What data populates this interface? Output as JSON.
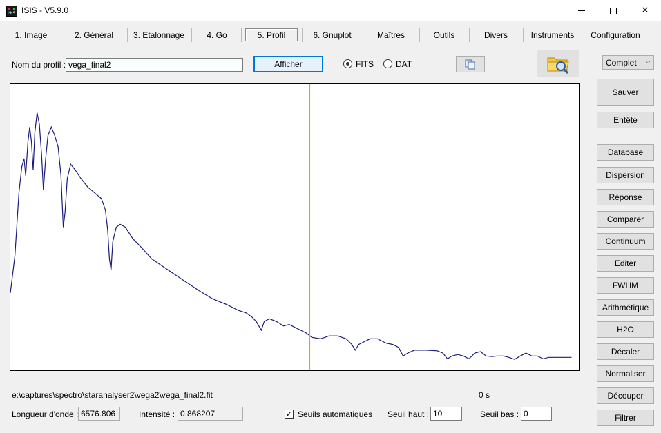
{
  "window": {
    "title": "ISIS - V5.9.0",
    "icon_text": "ISIS",
    "minimize_glyph": "",
    "maximize_glyph": "",
    "close_glyph": "✕"
  },
  "tabs": [
    {
      "label": "1. Image"
    },
    {
      "label": "2. Général"
    },
    {
      "label": "3. Etalonnage"
    },
    {
      "label": "4. Go"
    },
    {
      "label": "5. Profil",
      "active": true
    },
    {
      "label": "6. Gnuplot"
    },
    {
      "label": "Maîtres"
    },
    {
      "label": "Outils"
    },
    {
      "label": "Divers"
    },
    {
      "label": "Instruments"
    },
    {
      "label": "Configuration"
    }
  ],
  "profile": {
    "label": "Nom du profil :",
    "value": "vega_final2",
    "show_button": "Afficher",
    "format_options": [
      {
        "label": "FITS",
        "checked": true
      },
      {
        "label": "DAT",
        "checked": false
      }
    ],
    "copy_icon": "copy-icon",
    "open_icon": "folder-search-icon",
    "mode_select": "Complet",
    "mode_chevron": "⌵"
  },
  "chart_data": {
    "type": "line",
    "series_color": "#1a1a7a",
    "cursor_color": "#e0a030",
    "note": "spectrum profile, units not printed",
    "points_relative": [
      [
        0.0,
        0.27
      ],
      [
        0.008,
        0.4
      ],
      [
        0.015,
        0.62
      ],
      [
        0.02,
        0.71
      ],
      [
        0.024,
        0.74
      ],
      [
        0.027,
        0.68
      ],
      [
        0.031,
        0.8
      ],
      [
        0.034,
        0.85
      ],
      [
        0.037,
        0.8
      ],
      [
        0.04,
        0.7
      ],
      [
        0.043,
        0.83
      ],
      [
        0.047,
        0.9
      ],
      [
        0.051,
        0.86
      ],
      [
        0.055,
        0.75
      ],
      [
        0.058,
        0.63
      ],
      [
        0.062,
        0.74
      ],
      [
        0.066,
        0.82
      ],
      [
        0.072,
        0.85
      ],
      [
        0.078,
        0.82
      ],
      [
        0.084,
        0.78
      ],
      [
        0.089,
        0.68
      ],
      [
        0.093,
        0.5
      ],
      [
        0.096,
        0.55
      ],
      [
        0.1,
        0.67
      ],
      [
        0.106,
        0.72
      ],
      [
        0.114,
        0.7
      ],
      [
        0.124,
        0.67
      ],
      [
        0.136,
        0.64
      ],
      [
        0.148,
        0.62
      ],
      [
        0.16,
        0.6
      ],
      [
        0.167,
        0.56
      ],
      [
        0.171,
        0.49
      ],
      [
        0.174,
        0.39
      ],
      [
        0.177,
        0.35
      ],
      [
        0.18,
        0.45
      ],
      [
        0.186,
        0.5
      ],
      [
        0.193,
        0.51
      ],
      [
        0.202,
        0.5
      ],
      [
        0.215,
        0.46
      ],
      [
        0.23,
        0.43
      ],
      [
        0.248,
        0.39
      ],
      [
        0.27,
        0.36
      ],
      [
        0.3,
        0.32
      ],
      [
        0.33,
        0.28
      ],
      [
        0.355,
        0.25
      ],
      [
        0.38,
        0.23
      ],
      [
        0.4,
        0.21
      ],
      [
        0.415,
        0.2
      ],
      [
        0.425,
        0.185
      ],
      [
        0.432,
        0.17
      ],
      [
        0.438,
        0.15
      ],
      [
        0.441,
        0.14
      ],
      [
        0.446,
        0.17
      ],
      [
        0.455,
        0.18
      ],
      [
        0.468,
        0.17
      ],
      [
        0.48,
        0.155
      ],
      [
        0.49,
        0.16
      ],
      [
        0.5,
        0.15
      ],
      [
        0.51,
        0.14
      ],
      [
        0.52,
        0.13
      ],
      [
        0.53,
        0.115
      ],
      [
        0.545,
        0.11
      ],
      [
        0.56,
        0.12
      ],
      [
        0.575,
        0.12
      ],
      [
        0.59,
        0.11
      ],
      [
        0.6,
        0.09
      ],
      [
        0.606,
        0.07
      ],
      [
        0.612,
        0.09
      ],
      [
        0.622,
        0.1
      ],
      [
        0.632,
        0.11
      ],
      [
        0.645,
        0.11
      ],
      [
        0.66,
        0.095
      ],
      [
        0.672,
        0.09
      ],
      [
        0.682,
        0.08
      ],
      [
        0.69,
        0.05
      ],
      [
        0.698,
        0.06
      ],
      [
        0.71,
        0.07
      ],
      [
        0.73,
        0.07
      ],
      [
        0.75,
        0.068
      ],
      [
        0.76,
        0.06
      ],
      [
        0.768,
        0.04
      ],
      [
        0.776,
        0.05
      ],
      [
        0.786,
        0.055
      ],
      [
        0.796,
        0.05
      ],
      [
        0.806,
        0.04
      ],
      [
        0.816,
        0.06
      ],
      [
        0.826,
        0.065
      ],
      [
        0.836,
        0.05
      ],
      [
        0.846,
        0.048
      ],
      [
        0.856,
        0.05
      ],
      [
        0.866,
        0.05
      ],
      [
        0.876,
        0.045
      ],
      [
        0.886,
        0.038
      ],
      [
        0.896,
        0.05
      ],
      [
        0.906,
        0.06
      ],
      [
        0.916,
        0.05
      ],
      [
        0.926,
        0.05
      ],
      [
        0.936,
        0.04
      ],
      [
        0.946,
        0.045
      ],
      [
        0.956,
        0.045
      ],
      [
        0.966,
        0.045
      ],
      [
        0.976,
        0.045
      ],
      [
        0.986,
        0.045
      ]
    ],
    "x_range": [
      0,
      1
    ],
    "y_range": [
      0,
      1
    ],
    "grid": false
  },
  "status": {
    "file_path": "e:\\captures\\spectro\\staranalyser2\\vega2\\vega_final2.fit",
    "elapsed": "0 s",
    "wavelength_label": "Longueur d'onde :",
    "wavelength_value": "6576.806",
    "intensity_label": "Intensité :",
    "intensity_value": "0.868207",
    "auto_threshold_label": "Seuils automatiques",
    "auto_threshold_checked": true,
    "high_threshold_label": "Seuil haut :",
    "high_threshold_value": "10",
    "low_threshold_label": "Seuil bas :",
    "low_threshold_value": "0"
  },
  "side_buttons": {
    "save": "Sauver",
    "header": "Entête",
    "database": "Database",
    "dispersion": "Dispersion",
    "response": "Réponse",
    "compare": "Comparer",
    "continuum": "Continuum",
    "edit": "Editer",
    "fwhm": "FWHM",
    "arithmetic": "Arithmétique",
    "h2o": "H2O",
    "shift": "Décaler",
    "normalize": "Normaliser",
    "crop": "Découper",
    "filter": "Filtrer"
  }
}
